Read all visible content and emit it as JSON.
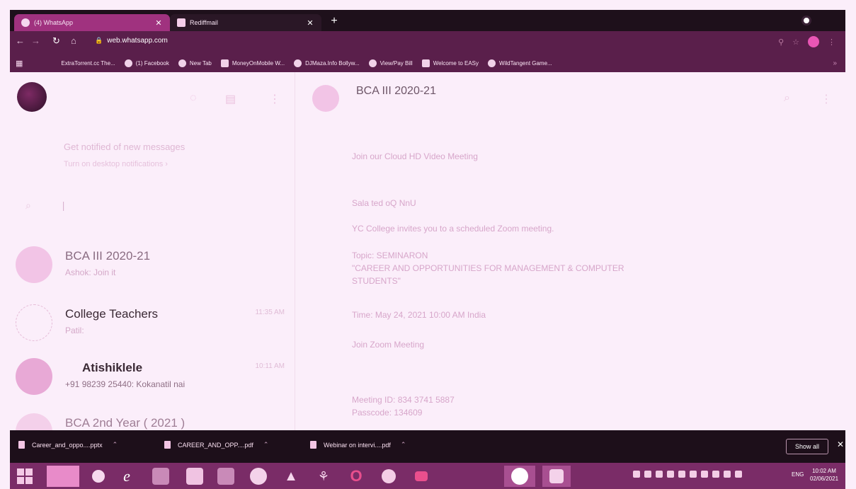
{
  "browser": {
    "tabs": [
      {
        "title": "(4) WhatsApp",
        "active": true
      },
      {
        "title": "Rediffmail",
        "active": false
      }
    ],
    "url": "web.whatsapp.com",
    "bookmarks": [
      "ExtraTorrent.cc The...",
      "(1) Facebook",
      "New Tab",
      "MoneyOnMobile W...",
      "DJMaza.Info Bollyw...",
      "View/Pay Bill",
      "Welcome to EASy",
      "WildTangent Game..."
    ]
  },
  "sidebar": {
    "notification": {
      "title": "Get notified of new messages",
      "link": "Turn on desktop notifications ›"
    },
    "chats": [
      {
        "name": "BCA III 2020-21",
        "snippet": "Ashok: Join it",
        "time": "",
        "avatar_color": "#f2c4e6"
      },
      {
        "name": "College Teachers",
        "snippet": "Patil:",
        "time": "11:35 AM",
        "avatar_color": "#fbeefa"
      },
      {
        "name": "Atishiklele",
        "snippet": "+91 98239 25440: Kokanatil nai",
        "time": "10:11 AM",
        "avatar_color": "#e8a9d6"
      },
      {
        "name": "BCA 2nd Year ( 2021 )",
        "snippet": "",
        "time": "",
        "avatar_color": "#f4d0ea"
      }
    ]
  },
  "conversation": {
    "title": "BCA III 2020-21",
    "messages": [
      {
        "text": "Join our Cloud HD Video Meeting",
        "faint": false
      },
      {
        "text": "Sala ted oQ NnU",
        "faint": false
      },
      {
        "text": "YC College  invites you to a scheduled Zoom meeting.",
        "faint": false
      },
      {
        "text": "Topic: SEMINARON",
        "faint": false
      },
      {
        "text": "\"CAREER AND OPPORTUNITIES FOR MANAGEMENT & COMPUTER",
        "faint": false
      },
      {
        "text": "STUDENTS\"",
        "faint": false
      },
      {
        "text": "Time: May 24, 2021 10:00 AM India",
        "faint": false
      },
      {
        "text": "Join Zoom Meeting",
        "faint": false
      },
      {
        "text": "Meeting ID: 834 3741 5887",
        "faint": false
      },
      {
        "text": "Passcode: 134609",
        "faint": false
      }
    ]
  },
  "downloads": {
    "items": [
      "Career_and_oppo....pptx",
      "CAREER_AND_OPP....pdf",
      "Webinar on intervi....pdf"
    ],
    "show_all": "Show all"
  },
  "taskbar": {
    "lang": "ENG",
    "time": "10:02 AM",
    "date": "02/06/2021"
  },
  "colors": {
    "accent": "#a0327f",
    "chrome": "#5a1f4b",
    "panel": "#fbeefa"
  }
}
